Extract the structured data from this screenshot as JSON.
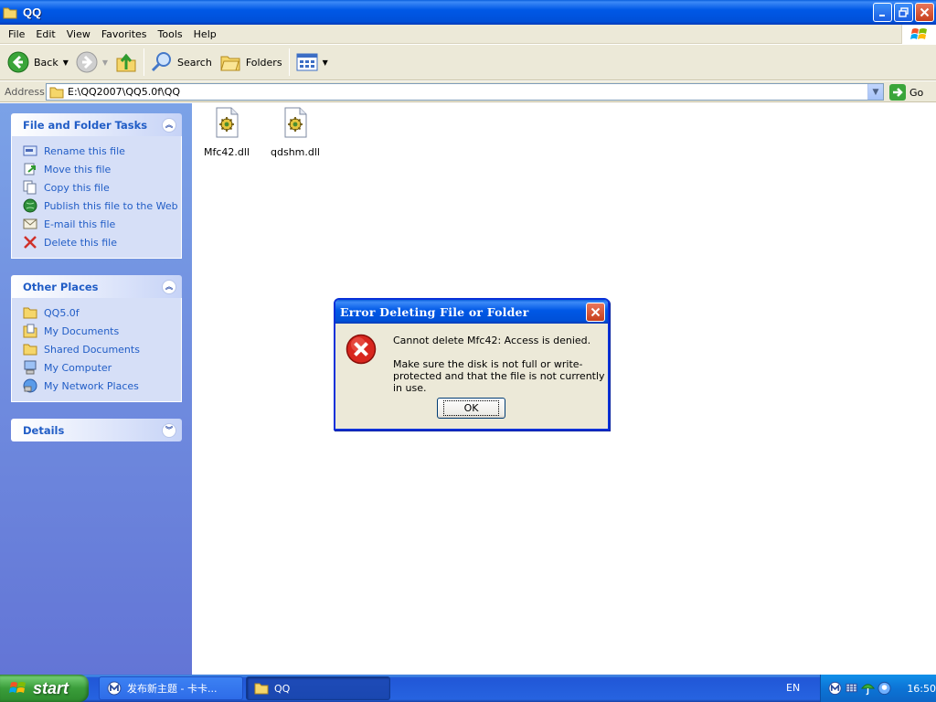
{
  "window": {
    "title": "QQ"
  },
  "menu": {
    "items": [
      "File",
      "Edit",
      "View",
      "Favorites",
      "Tools",
      "Help"
    ]
  },
  "toolbar": {
    "back_label": "Back",
    "search_label": "Search",
    "folders_label": "Folders"
  },
  "address": {
    "label": "Address",
    "value": "E:\\QQ2007\\QQ5.0f\\QQ",
    "go_label": "Go"
  },
  "tasks_panel": {
    "title": "File and Folder Tasks",
    "items": [
      {
        "label": "Rename this file",
        "icon": "rename-icon"
      },
      {
        "label": "Move this file",
        "icon": "move-icon"
      },
      {
        "label": "Copy this file",
        "icon": "copy-icon"
      },
      {
        "label": "Publish this file to the Web",
        "icon": "publish-icon"
      },
      {
        "label": "E-mail this file",
        "icon": "email-icon"
      },
      {
        "label": "Delete this file",
        "icon": "delete-icon"
      }
    ]
  },
  "places_panel": {
    "title": "Other Places",
    "items": [
      {
        "label": "QQ5.0f",
        "icon": "folder-icon"
      },
      {
        "label": "My Documents",
        "icon": "documents-icon"
      },
      {
        "label": "Shared Documents",
        "icon": "folder-icon"
      },
      {
        "label": "My Computer",
        "icon": "computer-icon"
      },
      {
        "label": "My Network Places",
        "icon": "network-icon"
      }
    ]
  },
  "details_panel": {
    "title": "Details"
  },
  "files": [
    {
      "name": "Mfc42.dll"
    },
    {
      "name": "qdshm.dll"
    }
  ],
  "dialog": {
    "title": "Error Deleting File or Folder",
    "message": "Cannot delete Mfc42: Access is denied.",
    "detail": "Make sure the disk is not full or write-protected and that the file is not currently in use.",
    "ok_label": "OK"
  },
  "taskbar": {
    "start_label": "start",
    "tasks": [
      {
        "label": "发布新主题 - 卡卡...",
        "active": false
      },
      {
        "label": "QQ",
        "active": true
      }
    ],
    "language": "EN",
    "clock": "16:50"
  }
}
